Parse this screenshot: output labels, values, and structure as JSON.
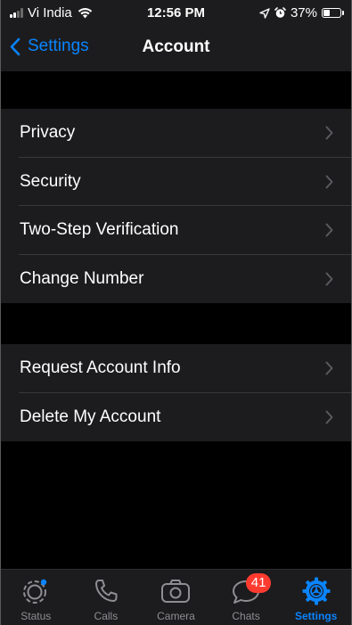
{
  "status_bar": {
    "carrier": "Vi India",
    "time": "12:56 PM",
    "battery_percent": "37%",
    "battery_level": 0.37,
    "icons": [
      "signal-bars-icon",
      "wifi-icon",
      "location-arrow-icon",
      "alarm-icon",
      "battery-icon"
    ]
  },
  "nav": {
    "back_label": "Settings",
    "back_icon": "chevron-left-icon",
    "title": "Account"
  },
  "groups": [
    {
      "items": [
        {
          "label": "Privacy"
        },
        {
          "label": "Security"
        },
        {
          "label": "Two-Step Verification"
        },
        {
          "label": "Change Number"
        }
      ]
    },
    {
      "items": [
        {
          "label": "Request Account Info"
        },
        {
          "label": "Delete My Account"
        }
      ]
    }
  ],
  "tab_bar": {
    "tabs": [
      {
        "label": "Status",
        "icon": "status-icon"
      },
      {
        "label": "Calls",
        "icon": "phone-icon"
      },
      {
        "label": "Camera",
        "icon": "camera-icon"
      },
      {
        "label": "Chats",
        "icon": "chat-bubble-icon",
        "badge": "41"
      },
      {
        "label": "Settings",
        "icon": "gear-icon",
        "active": true
      }
    ]
  },
  "colors": {
    "accent": "#0a84ff",
    "background": "#000000",
    "surface": "#1c1c1e",
    "separator": "#38383a",
    "inactive": "#8e8e93",
    "badge": "#ff3b30"
  }
}
